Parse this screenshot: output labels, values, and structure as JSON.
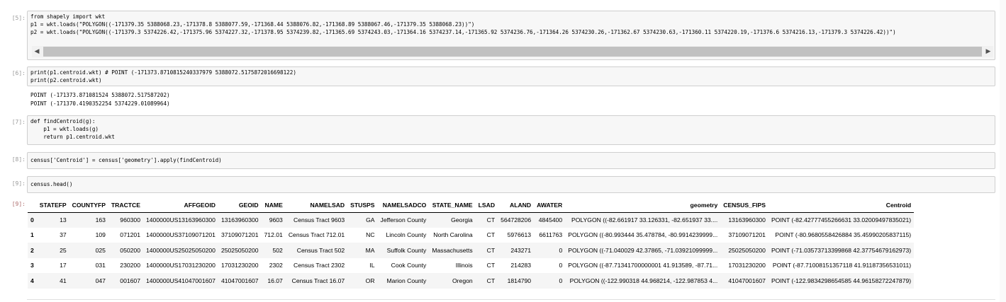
{
  "cells": [
    {
      "prompt": "[5]:",
      "lines": [
        "from shapely import wkt",
        "p1 = wkt.loads(\"POLYGON((-171379.35 5388068.23,-171378.8 5388077.59,-171368.44 5388076.82,-171368.89 5388067.46,-171379.35 5388068.23))\")",
        "p2 = wkt.loads(\"POLYGON((-171379.3 5374226.42,-171375.96 5374227.32,-171378.95 5374239.82,-171365.69 5374243.03,-171364.16 5374237.14,-171365.92 5374236.76,-171364.26 5374230.26,-171362.67 5374230.63,-171360.11 5374220.19,-171376.6 5374216.13,-171379.3 5374226.42))\")"
      ]
    },
    {
      "prompt": "[6]:",
      "lines": [
        "print(p1.centroid.wkt) # POINT (-171373.8710815240337979 5388072.5175872016698122)",
        "print(p2.centroid.wkt)"
      ],
      "output": [
        "POINT (-171373.871081524 5388072.517587202)",
        "POINT (-171370.4190352254 5374229.01089964)"
      ]
    },
    {
      "prompt": "[7]:",
      "lines": [
        "def findCentroid(g):",
        "    p1 = wkt.loads(g)",
        "    return p1.centroid.wkt"
      ]
    },
    {
      "prompt": "[8]:",
      "lines": [
        "census['Centroid'] = census['geometry'].apply(findCentroid)"
      ]
    },
    {
      "prompt": "[9]:",
      "lines": [
        "census.head()"
      ]
    }
  ],
  "output_prompt": "[9]:",
  "table": {
    "columns": [
      "",
      "STATEFP",
      "COUNTYFP",
      "TRACTCE",
      "AFFGEOID",
      "GEOID",
      "NAME",
      "NAMELSAD",
      "STUSPS",
      "NAMELSADCO",
      "STATE_NAME",
      "LSAD",
      "ALAND",
      "AWATER",
      "geometry",
      "CENSUS_FIPS",
      "Centroid"
    ],
    "rows": [
      [
        "0",
        "13",
        "163",
        "960300",
        "1400000US13163960300",
        "13163960300",
        "9603",
        "Census Tract 9603",
        "GA",
        "Jefferson County",
        "Georgia",
        "CT",
        "564728206",
        "4845400",
        "POLYGON ((-82.661917 33.126331, -82.651937 33....",
        "13163960300",
        "POINT (-82.42777455266631 33.02009497835021)"
      ],
      [
        "1",
        "37",
        "109",
        "071201",
        "1400000US37109071201",
        "37109071201",
        "712.01",
        "Census Tract 712.01",
        "NC",
        "Lincoln County",
        "North Carolina",
        "CT",
        "5976613",
        "6611763",
        "POLYGON ((-80.993444 35.478784, -80.9914239999...",
        "37109071201",
        "POINT (-80.9680558426884 35.45990205837115)"
      ],
      [
        "2",
        "25",
        "025",
        "050200",
        "1400000US25025050200",
        "25025050200",
        "502",
        "Census Tract 502",
        "MA",
        "Suffolk County",
        "Massachusetts",
        "CT",
        "243271",
        "0",
        "POLYGON ((-71.040029 42.37865, -71.03921099999...",
        "25025050200",
        "POINT (-71.03573713399868 42.37754679162973)"
      ],
      [
        "3",
        "17",
        "031",
        "230200",
        "1400000US17031230200",
        "17031230200",
        "2302",
        "Census Tract 2302",
        "IL",
        "Cook County",
        "Illinois",
        "CT",
        "214283",
        "0",
        "POLYGON ((-87.71341700000001 41.913589, -87.71...",
        "17031230200",
        "POINT (-87.71008151357118 41.91187356531011)"
      ],
      [
        "4",
        "41",
        "047",
        "001607",
        "1400000US41047001607",
        "41047001607",
        "16.07",
        "Census Tract 16.07",
        "OR",
        "Marion County",
        "Oregon",
        "CT",
        "1814790",
        "0",
        "POLYGON ((-122.990318 44.968214, -122.987853 4...",
        "41047001607",
        "POINT (-122.9834298654585 44.96158272247879)"
      ]
    ]
  }
}
